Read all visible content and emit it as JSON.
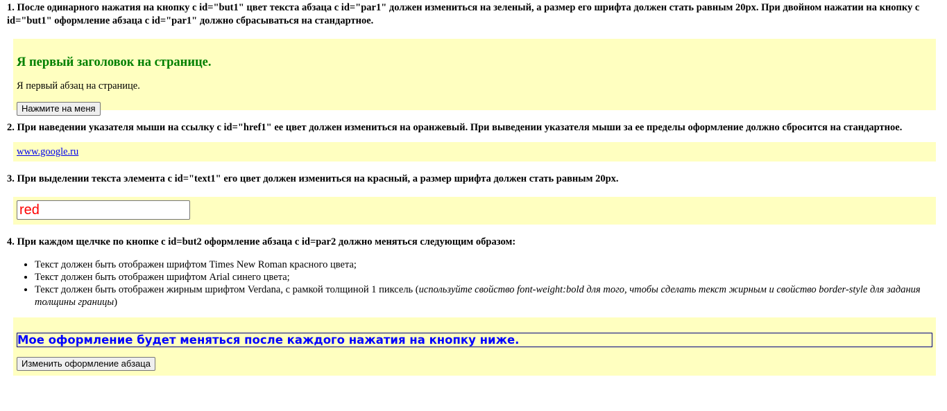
{
  "task1": {
    "text": "1. После одинарного нажатия на кнопку с id=\"but1\" цвет текста абзаца с id=\"par1\" должен измениться на зеленый, а размер его шрифта должен стать равным 20px. При двойном нажатии на кнопку с id=\"but1\" оформление абзаца с id=\"par1\" должно сбрасываться на стандартное.",
    "heading": "Я первый заголовок на странице.",
    "paragraph": "Я первый абзац на странице.",
    "button": "Нажмите на меня"
  },
  "task2": {
    "text": "2. При наведении указателя мыши на ссылку с id=\"href1\" ее цвет должен измениться на оранжевый. При выведении указателя мыши за ее пределы оформление должно сбросится на стандартное.",
    "link": "www.google.ru"
  },
  "task3": {
    "text": "3. При выделении текста элемента с id=\"text1\" его цвет должен измениться на красный, а размер шрифта должен стать равным 20px.",
    "input_value": "red"
  },
  "task4": {
    "text": "4. При каждом щелчке по кнопке с id=but2 оформление абзаца с id=par2 должно меняться следующим образом:",
    "items": [
      "Текст должен быть отображен шрифтом Times New Roman красного цвета;",
      "Текст должен быть отображен шрифтом Arial синего цвета;"
    ],
    "item3_text": "Текст должен быть отображен жирным шрифтом Verdana, с рамкой толщиной 1 пиксель (",
    "item3_em": "используйте свойство font-weight:bold для того, чтобы сделать текст жирным и свойство border-style для задания толщины границы",
    "item3_end": ")",
    "paragraph": "Мое оформление будет меняться после каждого нажатия на кнопку ниже.",
    "button": "Изменить оформление абзаца"
  },
  "colors": {
    "box_background": "#ffffc0",
    "heading_green": "#008000",
    "link_blue": "#0000ee",
    "input_red": "#ff0000",
    "par2_blue": "#0000ff"
  }
}
